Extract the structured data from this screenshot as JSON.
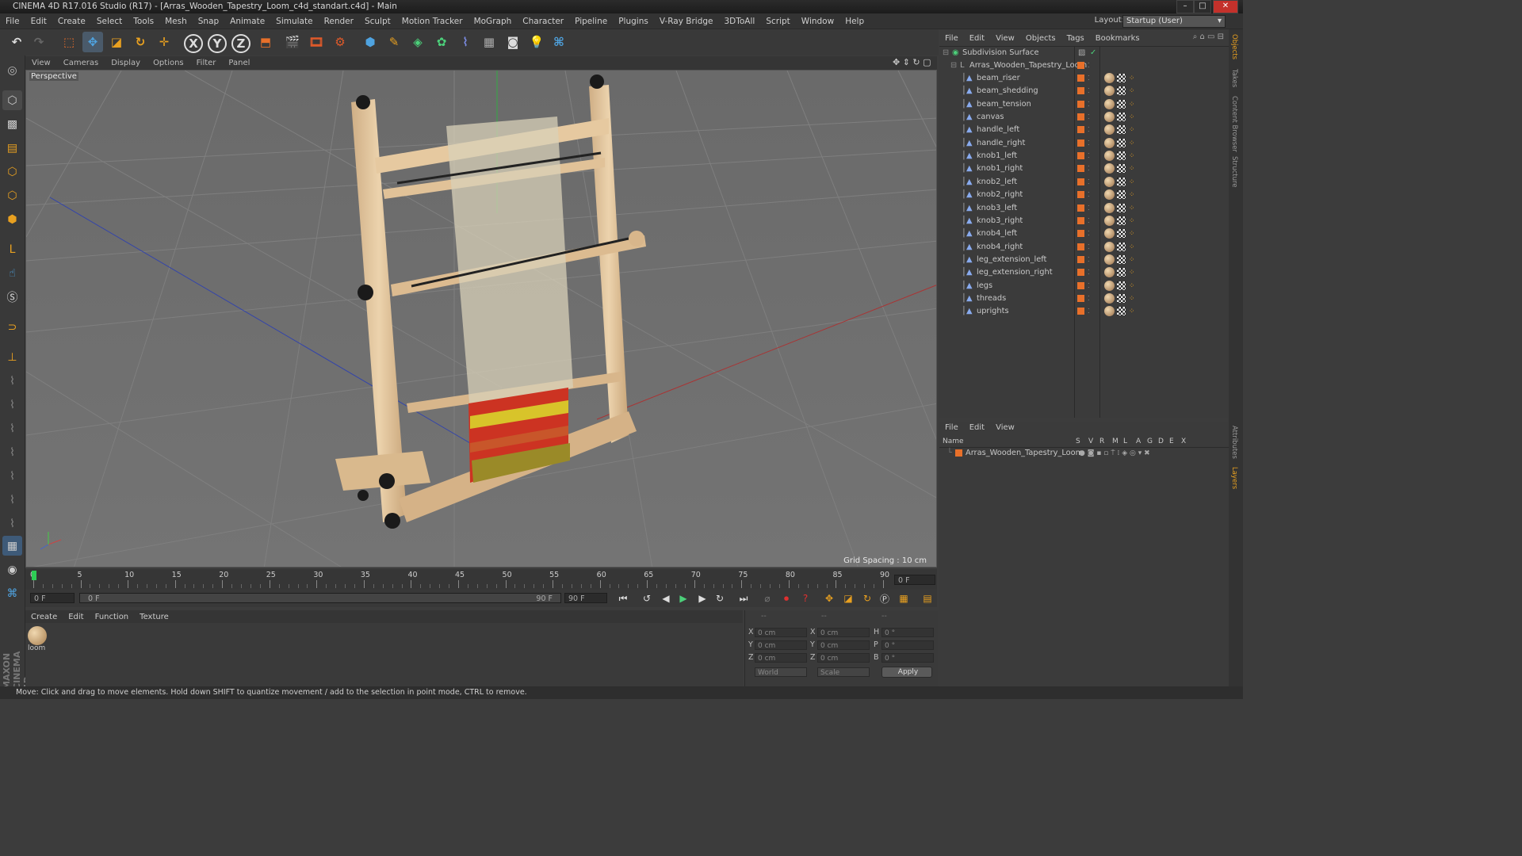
{
  "window": {
    "title": "CINEMA 4D R17.016 Studio (R17) - [Arras_Wooden_Tapestry_Loom_c4d_standart.c4d] - Main",
    "controls": [
      "–",
      "□",
      "✕"
    ]
  },
  "menu": [
    "File",
    "Edit",
    "Create",
    "Select",
    "Tools",
    "Mesh",
    "Snap",
    "Animate",
    "Simulate",
    "Render",
    "Sculpt",
    "Motion Tracker",
    "MoGraph",
    "Character",
    "Pipeline",
    "Plugins",
    "V-Ray Bridge",
    "3DToAll",
    "Script",
    "Window",
    "Help"
  ],
  "layout": {
    "label": "Layout:",
    "value": "Startup (User)"
  },
  "viewport": {
    "menu": [
      "View",
      "Cameras",
      "Display",
      "Options",
      "Filter",
      "Panel"
    ],
    "label": "Perspective",
    "grid_spacing": "Grid Spacing : 10 cm"
  },
  "timeline": {
    "ticks": [
      "0",
      "5",
      "10",
      "15",
      "20",
      "25",
      "30",
      "35",
      "40",
      "45",
      "50",
      "55",
      "60",
      "65",
      "70",
      "75",
      "80",
      "85",
      "90"
    ],
    "current_frame": "0 F",
    "start": "0 F",
    "range_left": "0 F",
    "range_right": "90 F",
    "end": "90 F"
  },
  "material_manager": {
    "menu": [
      "Create",
      "Edit",
      "Function",
      "Texture"
    ],
    "materials": [
      {
        "name": "loom"
      }
    ]
  },
  "coordinates": {
    "headers": [
      "--",
      "--",
      "--"
    ],
    "rows": [
      {
        "a": "X",
        "av": "0 cm",
        "b": "X",
        "bv": "0 cm",
        "c": "H",
        "cv": "0 °"
      },
      {
        "a": "Y",
        "av": "0 cm",
        "b": "Y",
        "bv": "0 cm",
        "c": "P",
        "cv": "0 °"
      },
      {
        "a": "Z",
        "av": "0 cm",
        "b": "Z",
        "bv": "0 cm",
        "c": "B",
        "cv": "0 °"
      }
    ],
    "mode": "World",
    "transform": "Scale",
    "apply": "Apply"
  },
  "object_manager": {
    "menu": [
      "File",
      "Edit",
      "View",
      "Objects",
      "Tags",
      "Bookmarks"
    ],
    "root": "Subdivision Surface",
    "group": "Arras_Wooden_Tapestry_Loom",
    "objects": [
      "beam_riser",
      "beam_shedding",
      "beam_tension",
      "canvas",
      "handle_left",
      "handle_right",
      "knob1_left",
      "knob1_right",
      "knob2_left",
      "knob2_right",
      "knob3_left",
      "knob3_right",
      "knob4_left",
      "knob4_right",
      "leg_extension_left",
      "leg_extension_right",
      "legs",
      "threads",
      "uprights"
    ]
  },
  "layer_manager": {
    "menu": [
      "File",
      "Edit",
      "View"
    ],
    "columns": [
      "Name",
      "S",
      "V",
      "R",
      "M",
      "L",
      "A",
      "G",
      "D",
      "E",
      "X"
    ],
    "layers": [
      "Arras_Wooden_Tapestry_Loom"
    ]
  },
  "right_tabs": [
    "Objects",
    "Takes",
    "Content Browser",
    "Structure",
    "Attributes",
    "Layers"
  ],
  "brand": "MAXON CINEMA 4D",
  "status": "Move: Click and drag to move elements. Hold down SHIFT to quantize movement / add to the selection in point mode, CTRL to remove.",
  "colors": {
    "accent": "#e8702a",
    "bg": "#3b3b3b"
  }
}
